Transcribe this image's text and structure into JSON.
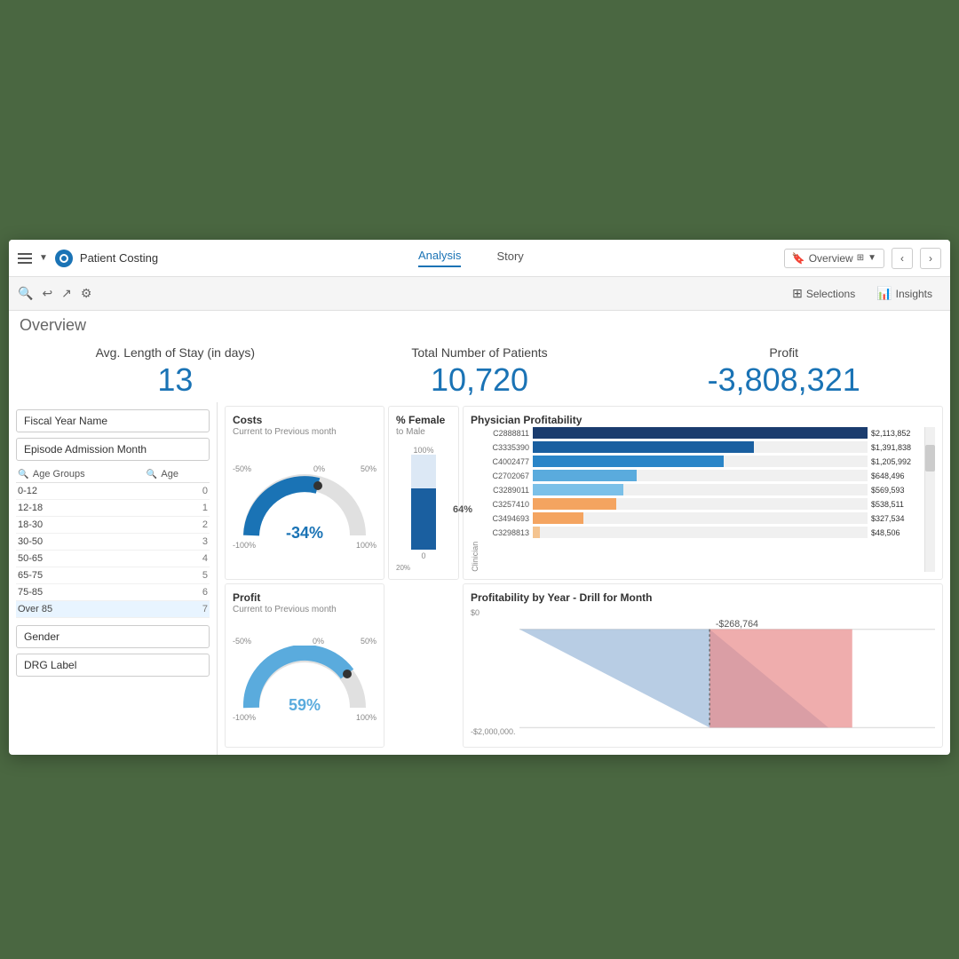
{
  "app": {
    "title": "Patient Costing",
    "tabs": [
      {
        "label": "Analysis",
        "active": true
      },
      {
        "label": "Story",
        "active": false
      }
    ],
    "nav_right": {
      "overview_label": "Overview",
      "selections_label": "Selections",
      "insights_label": "Insights"
    }
  },
  "overview": {
    "label": "Overview"
  },
  "kpis": {
    "avg_stay": {
      "label": "Avg. Length of Stay (in days)",
      "value": "13"
    },
    "total_patients": {
      "label": "Total Number of Patients",
      "value": "10,720"
    },
    "profit": {
      "label": "Profit",
      "value": "-3,808,321"
    }
  },
  "filters": {
    "fiscal_year_name": "Fiscal Year Name",
    "episode_admission_month": "Episode Admission Month",
    "age_groups_col": "Age Groups",
    "age_col": "Age",
    "age_rows": [
      {
        "group": "0-12",
        "value": "0"
      },
      {
        "group": "12-18",
        "value": "1"
      },
      {
        "group": "18-30",
        "value": "2"
      },
      {
        "group": "30-50",
        "value": "3"
      },
      {
        "group": "50-65",
        "value": "4"
      },
      {
        "group": "65-75",
        "value": "5"
      },
      {
        "group": "75-85",
        "value": "6"
      },
      {
        "group": "Over 85",
        "value": "7"
      }
    ],
    "gender_label": "Gender",
    "drg_label": "DRG Label"
  },
  "charts": {
    "costs": {
      "title": "Costs",
      "subtitle": "Current to Previous month",
      "value": "-34%",
      "color": "#1a73b5"
    },
    "profit_donut": {
      "title": "Profit",
      "subtitle": "Current to Previous month",
      "value": "59%",
      "color": "#5aabdd"
    },
    "female_pct": {
      "title": "% Female",
      "subtitle": "to Male",
      "value": "64%"
    },
    "physician": {
      "title": "Physician Profitability",
      "clinician_label": "Clinician",
      "rows": [
        {
          "id": "C2888811",
          "value": "$2,113,852",
          "pct": 100,
          "color": "#1a3c6e"
        },
        {
          "id": "C3335390",
          "value": "$1,391,838",
          "pct": 66,
          "color": "#1a5fa0"
        },
        {
          "id": "C4002477",
          "value": "$1,205,992",
          "pct": 57,
          "color": "#2a85c8"
        },
        {
          "id": "C2702067",
          "value": "$648,496",
          "pct": 31,
          "color": "#5aabdd"
        },
        {
          "id": "C3289011",
          "value": "$569,593",
          "pct": 27,
          "color": "#7bc0e8"
        },
        {
          "id": "C3257410",
          "value": "$538,511",
          "pct": 25,
          "color": "#f4a460"
        },
        {
          "id": "C3494693",
          "value": "$327,534",
          "pct": 15,
          "color": "#f4a460"
        },
        {
          "id": "C3298813",
          "value": "$48,506",
          "pct": 2,
          "color": "#f4c490"
        }
      ]
    },
    "profit_year": {
      "title": "Profitability by Year - Drill for Month",
      "y_labels": [
        "$0",
        "-$2,000,000."
      ],
      "annotation": "-$268,764"
    }
  }
}
